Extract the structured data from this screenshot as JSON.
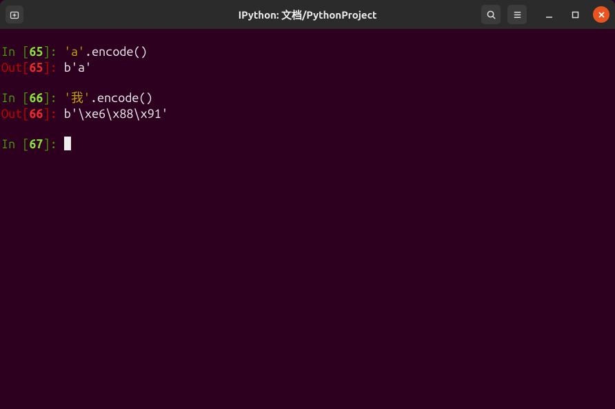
{
  "window": {
    "title": "IPython: 文档/PythonProject"
  },
  "cells": [
    {
      "in_prefix": "In [",
      "in_num": "65",
      "in_suffix": "]: ",
      "string_part": "'a'",
      "code_rest": ".encode()",
      "out_prefix": "Out[",
      "out_num": "65",
      "out_suffix": "]: ",
      "output": "b'a'"
    },
    {
      "in_prefix": "In [",
      "in_num": "66",
      "in_suffix": "]: ",
      "string_part": "'我'",
      "code_rest": ".encode()",
      "out_prefix": "Out[",
      "out_num": "66",
      "out_suffix": "]: ",
      "output": "b'\\xe6\\x88\\x91'"
    }
  ],
  "prompt": {
    "in_prefix": "In [",
    "in_num": "67",
    "in_suffix": "]: "
  }
}
